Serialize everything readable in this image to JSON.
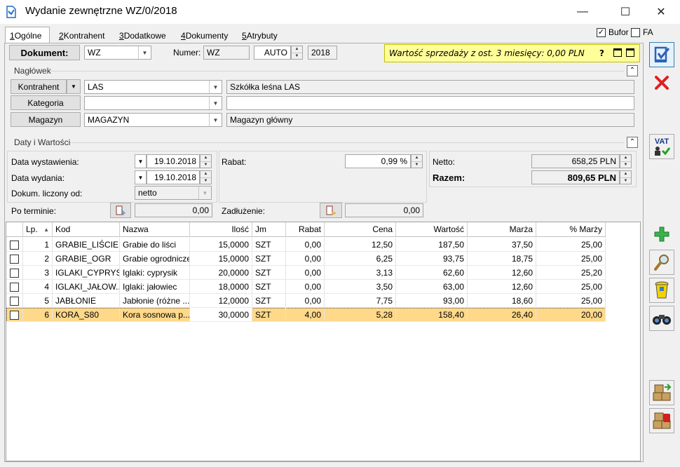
{
  "window": {
    "title": "Wydanie zewnętrzne WZ/0/2018",
    "minimize": "—",
    "maximize": "☐",
    "close": "✕"
  },
  "tabs": [
    {
      "key": "1",
      "label": " Ogólne"
    },
    {
      "key": "2",
      "label": " Kontrahent"
    },
    {
      "key": "3",
      "label": " Dodatkowe"
    },
    {
      "key": "4",
      "label": " Dokumenty"
    },
    {
      "key": "5",
      "label": " Atrybuty"
    }
  ],
  "flags": {
    "bufor_label": "Bufor",
    "bufor_checked": true,
    "fa_label": "FA",
    "fa_checked": false
  },
  "document": {
    "button_label": "Dokument:",
    "type_value": "WZ",
    "numer_label": "Numer:",
    "numer_prefix": "WZ",
    "numer_auto": "AUTO",
    "numer_year": "2018"
  },
  "notice": {
    "text": "Wartość sprzedaży z ost. 3 miesięcy: 0,00 PLN",
    "help": "?"
  },
  "naglowek": {
    "title": "Nagłówek",
    "kontrahent_label": "Kontrahent",
    "kontrahent_value": "LAS",
    "kontrahent_name": "Szkółka leśna LAS",
    "kategoria_label": "Kategoria",
    "kategoria_value": "",
    "kategoria_desc": "",
    "magazyn_label": "Magazyn",
    "magazyn_value": "MAGAZYN",
    "magazyn_name": "Magazyn główny"
  },
  "daty": {
    "title": "Daty i Wartości",
    "wystawienia_label": "Data wystawienia:",
    "wystawienia_value": "19.10.2018",
    "wydania_label": "Data wydania:",
    "wydania_value": "19.10.2018",
    "liczony_label": "Dokum. liczony od:",
    "liczony_value": "netto",
    "po_terminie_label": "Po terminie:",
    "po_terminie_value": "0,00",
    "rabat_label": "Rabat:",
    "rabat_value": "0,99 %",
    "zadluzenie_label": "Zadłużenie:",
    "zadluzenie_value": "0,00",
    "netto_label": "Netto:",
    "netto_value": "658,25 PLN",
    "razem_label": "Razem:",
    "razem_value": "809,65 PLN"
  },
  "grid": {
    "columns": [
      "Lp.",
      "Kod",
      "Nazwa",
      "Ilość",
      "Jm",
      "Rabat",
      "Cena",
      "Wartość",
      "Marża",
      "% Marży"
    ],
    "rows": [
      {
        "lp": "1",
        "kod": "GRABIE_LIŚCIE",
        "nazwa": "Grabie do liści",
        "ilosc": "15,0000",
        "jm": "SZT",
        "rabat": "0,00",
        "cena": "12,50",
        "wartosc": "187,50",
        "marza": "37,50",
        "pmarzy": "25,00"
      },
      {
        "lp": "2",
        "kod": "GRABIE_OGR",
        "nazwa": "Grabie ogrodnicze",
        "ilosc": "15,0000",
        "jm": "SZT",
        "rabat": "0,00",
        "cena": "6,25",
        "wartosc": "93,75",
        "marza": "18,75",
        "pmarzy": "25,00"
      },
      {
        "lp": "3",
        "kod": "IGLAKI_CYPRYS",
        "nazwa": "Iglaki: cyprysik",
        "ilosc": "20,0000",
        "jm": "SZT",
        "rabat": "0,00",
        "cena": "3,13",
        "wartosc": "62,60",
        "marza": "12,60",
        "pmarzy": "25,20"
      },
      {
        "lp": "4",
        "kod": "IGLAKI_JAŁOW...",
        "nazwa": "Iglaki: jałowiec",
        "ilosc": "18,0000",
        "jm": "SZT",
        "rabat": "0,00",
        "cena": "3,50",
        "wartosc": "63,00",
        "marza": "12,60",
        "pmarzy": "25,00"
      },
      {
        "lp": "5",
        "kod": "JABŁONIE",
        "nazwa": "Jabłonie (różne ...",
        "ilosc": "12,0000",
        "jm": "SZT",
        "rabat": "0,00",
        "cena": "7,75",
        "wartosc": "93,00",
        "marza": "18,60",
        "pmarzy": "25,00"
      },
      {
        "lp": "6",
        "kod": "KORA_S80",
        "nazwa": "Kora sosnowa p...",
        "ilosc": "30,0000",
        "jm": "SZT",
        "rabat": "4,00",
        "cena": "5,28",
        "wartosc": "158,40",
        "marza": "26,40",
        "pmarzy": "20,00"
      }
    ]
  },
  "side": {
    "vat_label": "VAT"
  },
  "colors": {
    "selected_row": "#ffd98a",
    "notice_bg": "#ffff99"
  }
}
